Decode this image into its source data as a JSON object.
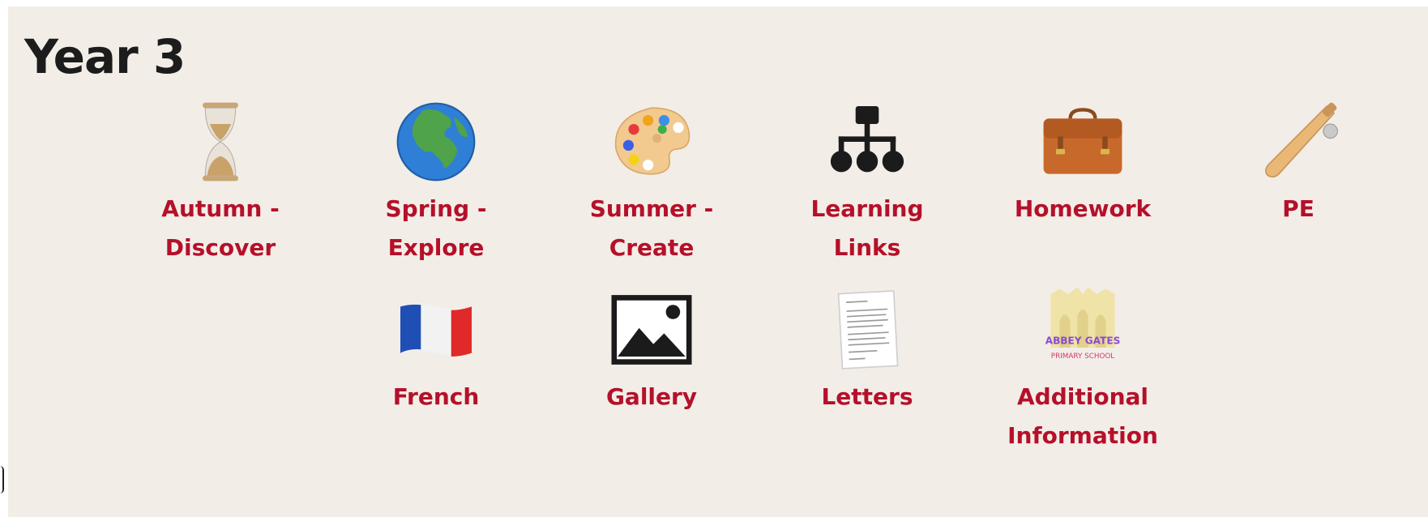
{
  "page": {
    "title": "Year 3"
  },
  "tiles": [
    {
      "label": "Autumn - Discover",
      "icon": "hourglass-icon"
    },
    {
      "label": "Spring - Explore",
      "icon": "globe-icon"
    },
    {
      "label": "Summer - Create",
      "icon": "paint-palette-icon"
    },
    {
      "label": "Learning Links",
      "icon": "sitemap-icon"
    },
    {
      "label": "Homework",
      "icon": "briefcase-icon"
    },
    {
      "label": "PE",
      "icon": "cricket-bat-icon"
    },
    {
      "label": "French",
      "icon": "french-flag-icon"
    },
    {
      "label": "Gallery",
      "icon": "image-icon"
    },
    {
      "label": "Letters",
      "icon": "letter-document-icon"
    },
    {
      "label": "Additional Information",
      "icon": "school-logo-icon"
    }
  ],
  "logo": {
    "text_top": "ABBEY GATES",
    "text_bottom": "PRIMARY SCHOOL"
  },
  "colors": {
    "label": "#b5102a",
    "title": "#1c1c1c",
    "background": "#f2ede7"
  }
}
